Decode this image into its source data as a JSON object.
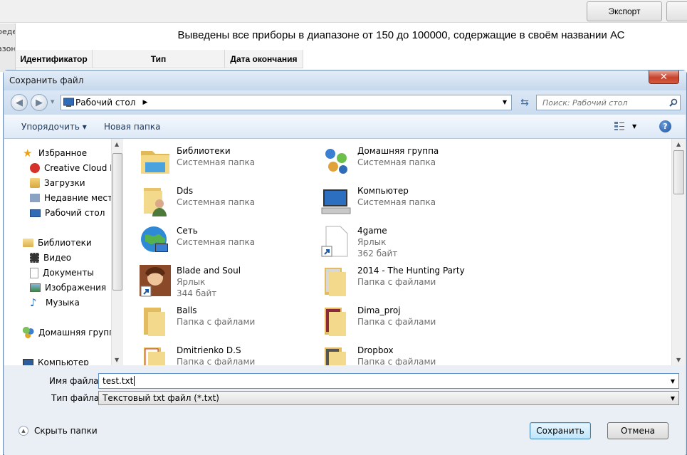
{
  "app": {
    "export_label": "Экспорт",
    "left_fragments": [
      "реде",
      "азон"
    ],
    "caption": "Выведены все приборы в диапазоне от 150 до 100000, содержащие в своём названии АС",
    "columns": [
      "Идентификатор",
      "Тип",
      "Дата окончания"
    ]
  },
  "dialog": {
    "title": "Сохранить файл",
    "close_label": "✕",
    "address": "Рабочий стол",
    "search_placeholder": "Поиск: Рабочий стол",
    "toolbar": {
      "organize_label": "Упорядочить ▾",
      "new_folder_label": "Новая папка",
      "help_label": "?"
    },
    "nav": {
      "favorites_label": "Избранное",
      "favorites": [
        "Creative Cloud Fi",
        "Загрузки",
        "Недавние места",
        "Рабочий стол"
      ],
      "libraries_label": "Библиотеки",
      "libraries": [
        "Видео",
        "Документы",
        "Изображения",
        "Музыка"
      ],
      "homegroup_label": "Домашняя группа",
      "computer_label": "Компьютер"
    },
    "files": [
      {
        "name": "Библиотеки",
        "sub": "Системная папка",
        "icon": "libraries-icon"
      },
      {
        "name": "Домашняя группа",
        "sub": "Системная папка",
        "icon": "homegroup-icon"
      },
      {
        "name": "Dds",
        "sub": "Системная папка",
        "icon": "user-folder-icon"
      },
      {
        "name": "Компьютер",
        "sub": "Системная папка",
        "icon": "computer-icon"
      },
      {
        "name": "Сеть",
        "sub": "Системная папка",
        "icon": "network-icon"
      },
      {
        "name": "4game",
        "sub": "Ярлык",
        "sub2": "362 байт",
        "icon": "shortcut-icon"
      },
      {
        "name": "Blade and Soul",
        "sub": "Ярлык",
        "sub2": "344 байт",
        "icon": "game-shortcut-icon"
      },
      {
        "name": "2014 - The Hunting Party",
        "sub": "Папка с файлами",
        "icon": "folder-icon"
      },
      {
        "name": "Balls",
        "sub": "Папка с файлами",
        "icon": "folder-icon"
      },
      {
        "name": "Dima_proj",
        "sub": "Папка с файлами",
        "icon": "folder-icon"
      },
      {
        "name": "Dmitrienko D.S",
        "sub": "Папка с файлами",
        "icon": "folder-icon"
      },
      {
        "name": "Dropbox",
        "sub": "Папка с файлами",
        "icon": "folder-icon"
      }
    ],
    "filename_label": "Имя файла:",
    "filename_value": "test.txt",
    "filetype_label": "Тип файла:",
    "filetype_value": "Текстовый txt файл (*.txt)",
    "hide_folders_label": "Скрыть папки",
    "save_label": "Сохранить",
    "cancel_label": "Отмена"
  }
}
